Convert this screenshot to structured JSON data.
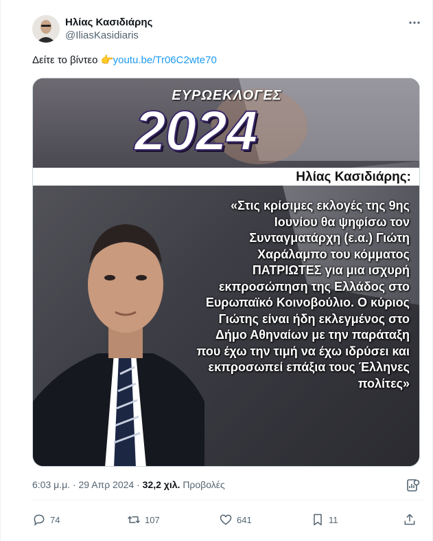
{
  "author": {
    "display_name": "Ηλίας Κασιδιάρης",
    "handle": "@IliasKasidiaris",
    "avatar_icon": "avatar-photo"
  },
  "more_icon": "more-dots-icon",
  "tweet": {
    "text_prefix": "Δείτε το βίντεο ",
    "emoji": "👉",
    "link_text": "youtu.be/Tr06C2wte70"
  },
  "media": {
    "title_small": "ΕΥΡΩΕΚΛΟΓΕΣ",
    "title_big": "2024",
    "speaker": "Ηλίας Κασιδιάρης:",
    "quote_lines": [
      "«Στις κρίσιμες εκλογές της 9ης",
      "Ιουνίου θα ψηφίσω τον",
      "Συνταγματάρχη (ε.α.) Γιώτη",
      "Χαράλαμπο  του κόμματος",
      "ΠΑΤΡΙΩΤΕΣ για μια ισχυρή",
      "εκπροσώπηση της Ελλάδος στο",
      "Ευρωπαϊκό Κοινοβούλιο. Ο κύριος",
      "Γιώτης είναι ήδη εκλεγμένος στο",
      "Δήμο Αθηναίων με την παράταξη",
      "που έχω την τιμή να έχω ιδρύσει και",
      "εκπροσωπεί επάξια τους Έλληνες",
      "πολίτες»"
    ]
  },
  "meta": {
    "time": "6:03 μ.μ.",
    "separator": " · ",
    "date": "29 Απρ 2024",
    "views_count": "32,2 χιλ.",
    "views_label": "Προβολές"
  },
  "actions": {
    "replies": "74",
    "reposts": "107",
    "likes": "641",
    "bookmarks": "11"
  },
  "colors": {
    "link": "#1d9bf0",
    "secondary_text": "#536471",
    "primary_text": "#0f1419"
  }
}
